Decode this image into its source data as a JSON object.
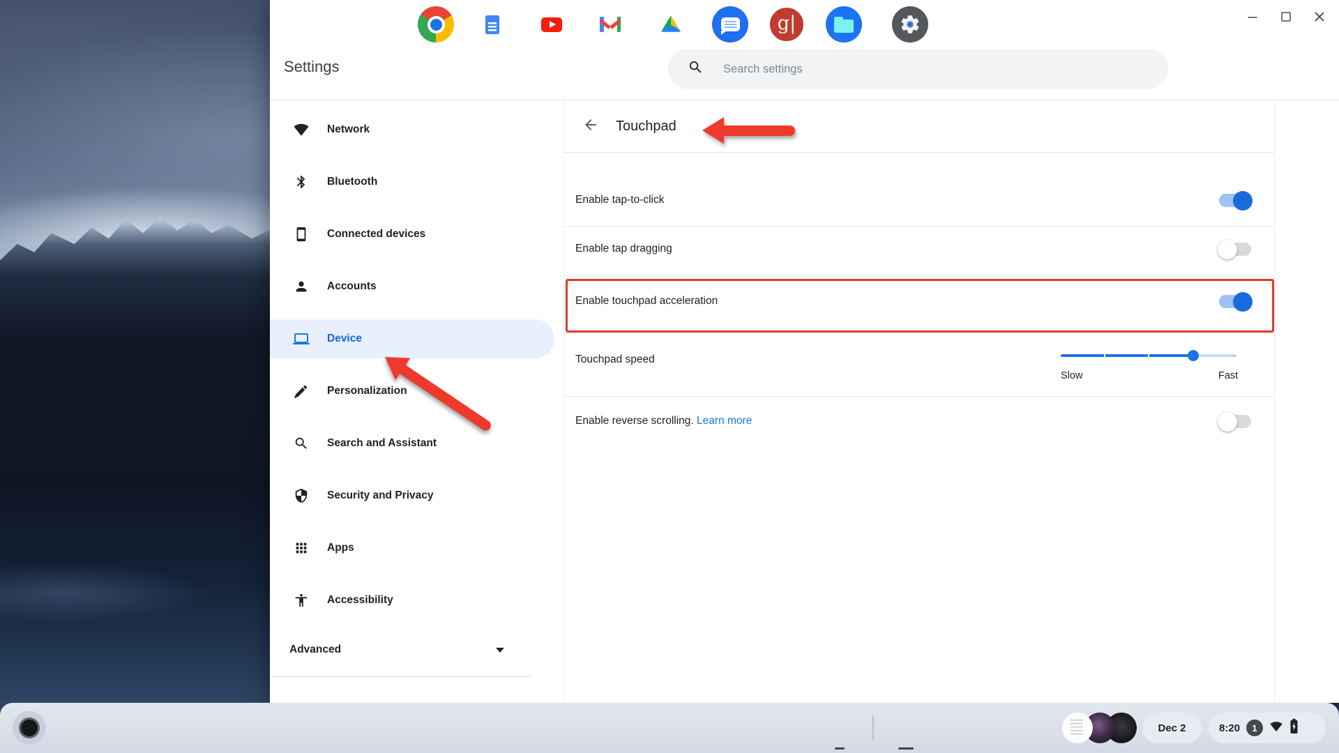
{
  "window": {
    "title": "Settings",
    "controls": {
      "minimize": "minimize",
      "maximize": "maximize",
      "close": "close"
    }
  },
  "search": {
    "placeholder": "Search settings"
  },
  "sidebar": {
    "items": [
      {
        "label": "Network",
        "icon": "wifi-icon",
        "selected": false
      },
      {
        "label": "Bluetooth",
        "icon": "bluetooth-icon",
        "selected": false
      },
      {
        "label": "Connected devices",
        "icon": "smartphone-icon",
        "selected": false
      },
      {
        "label": "Accounts",
        "icon": "person-icon",
        "selected": false
      },
      {
        "label": "Device",
        "icon": "laptop-icon",
        "selected": true
      },
      {
        "label": "Personalization",
        "icon": "paint-pen-icon",
        "selected": false
      },
      {
        "label": "Search and Assistant",
        "icon": "search-icon",
        "selected": false
      },
      {
        "label": "Security and Privacy",
        "icon": "shield-icon",
        "selected": false
      },
      {
        "label": "Apps",
        "icon": "apps-grid-icon",
        "selected": false
      },
      {
        "label": "Accessibility",
        "icon": "accessibility-icon",
        "selected": false
      }
    ],
    "advanced": {
      "label": "Advanced"
    }
  },
  "page": {
    "title": "Touchpad",
    "rows": [
      {
        "label": "Enable tap-to-click",
        "control": "toggle",
        "state": "on"
      },
      {
        "label": "Enable tap dragging",
        "control": "toggle",
        "state": "off"
      },
      {
        "label": "Enable touchpad acceleration",
        "control": "toggle",
        "state": "on",
        "highlighted": true
      },
      {
        "label": "Touchpad speed",
        "control": "slider",
        "value_percent": 76,
        "min_label": "Slow",
        "max_label": "Fast"
      },
      {
        "label": "Enable reverse scrolling.",
        "link_label": "Learn more",
        "control": "toggle",
        "state": "off"
      }
    ]
  },
  "annotations": {
    "color": "#ee3a2c",
    "highlight_row": "Enable touchpad acceleration",
    "arrow_targets": [
      "Touchpad",
      "Device"
    ]
  },
  "shelf": {
    "apps": [
      {
        "name": "Chrome"
      },
      {
        "name": "Google Docs"
      },
      {
        "name": "YouTube"
      },
      {
        "name": "Gmail"
      },
      {
        "name": "Google Drive"
      },
      {
        "name": "Messages"
      },
      {
        "name": "Google Scholar",
        "glyph": "g|"
      },
      {
        "name": "Files",
        "running": true
      },
      {
        "name": "Settings",
        "running": true
      }
    ],
    "status": {
      "date": "Dec 2",
      "time": "8:20",
      "notification_count": "1"
    }
  }
}
